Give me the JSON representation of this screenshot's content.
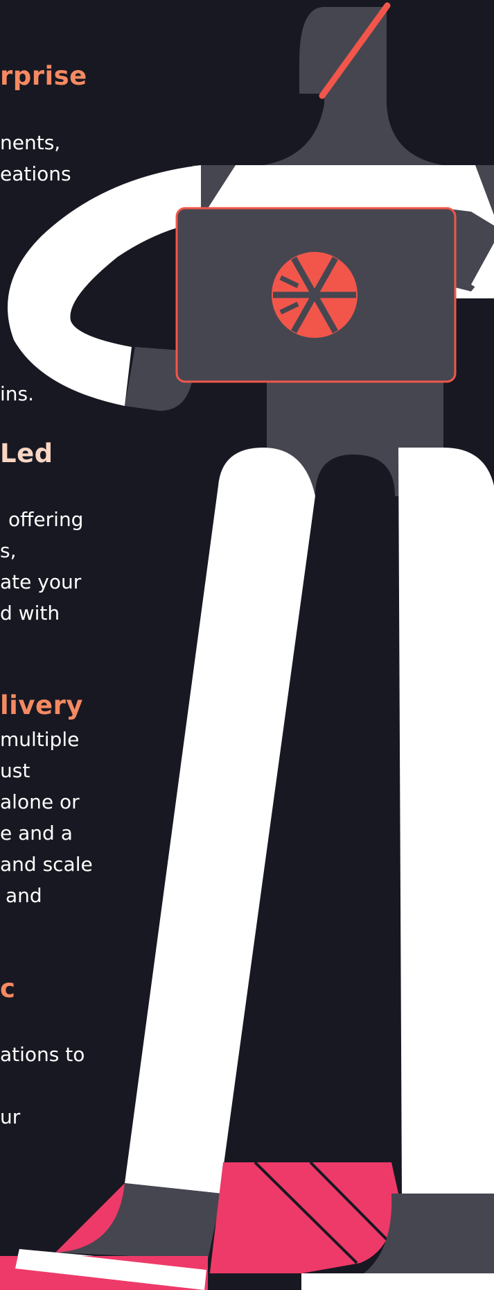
{
  "colors": {
    "background": "#181822",
    "heading_orange": "#f58a62",
    "heading_peach": "#f9d6c4",
    "body_text": "#ffffff",
    "figure_gray": "#464650",
    "figure_white": "#ffffff",
    "accent_red": "#f2564b",
    "shoe_pink": "#ee3a69"
  },
  "sections": {
    "enterprise": {
      "heading": "rprise",
      "lines": [
        "nents,",
        "eations"
      ]
    },
    "plugins": {
      "lines": [
        "ins."
      ]
    },
    "led": {
      "heading": "Led",
      "lines": [
        "offering",
        "s,",
        "ate your",
        "d with"
      ]
    },
    "delivery": {
      "heading": "livery",
      "lines": [
        "multiple",
        "ust",
        "alone or",
        "e and a",
        "and scale",
        "and"
      ]
    },
    "agnostic": {
      "heading": "c",
      "lines": [
        "ations to",
        "",
        "ur"
      ]
    }
  },
  "illustration": {
    "laptop_logo_icon": "snowflake-logo-icon",
    "character": "developer-holding-laptop"
  }
}
